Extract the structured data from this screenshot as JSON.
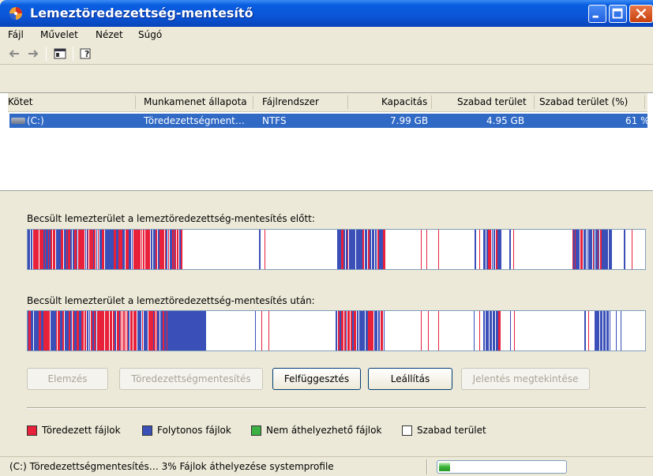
{
  "window": {
    "title": "Lemeztöredezettség-mentesítő"
  },
  "menu": [
    "Fájl",
    "Művelet",
    "Nézet",
    "Súgó"
  ],
  "list": {
    "columns": [
      "Kötet",
      "Munkamenet állapota",
      "Fájlrendszer",
      "Kapacitás",
      "Szabad terület",
      "Szabad terület (%)"
    ],
    "rows": [
      {
        "volume": "(C:)",
        "status": "Töredezettségment…",
        "fs": "NTFS",
        "capacity": "7.99 GB",
        "free": "4.95 GB",
        "free_pct": "61 %"
      }
    ]
  },
  "analysis": {
    "before_label": "Becsült lemezterület a lemeztöredezettség-mentesítés előtt:",
    "after_label": "Becsült lemezterület a lemeztöredezettség-mentesítés után:"
  },
  "buttons": {
    "analyze": "Elemzés",
    "defrag": "Töredezettségmentesítés",
    "pause": "Felfüggesztés",
    "stop": "Leállítás",
    "report": "Jelentés megtekintése"
  },
  "legend": {
    "fragmented": "Töredezett fájlok",
    "contiguous": "Folytonos fájlok",
    "unmovable": "Nem áthelyezhető fájlok",
    "free": "Szabad terület"
  },
  "colors": {
    "fragmented": "#e8213a",
    "contiguous": "#3a4fb8",
    "unmovable": "#3cb043",
    "free": "#ffffff"
  },
  "status": {
    "text": "(C:) Töredezettségmentesítés… 3%  Fájlok áthelyezése systemprofile",
    "progress": 0.03
  }
}
